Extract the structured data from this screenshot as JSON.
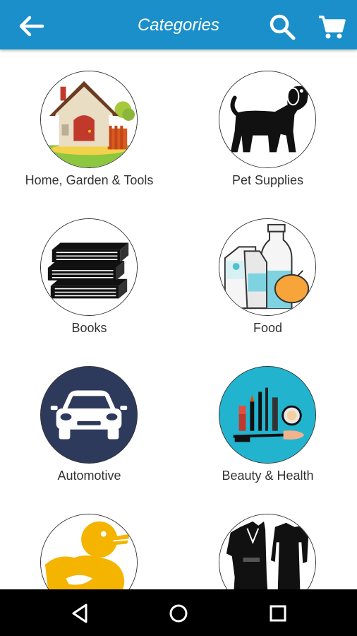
{
  "appbar": {
    "title": "Categories",
    "color": "#1a8fc9",
    "icons": {
      "back": "arrow-left-icon",
      "search": "search-icon",
      "cart": "shopping-cart-icon"
    }
  },
  "categories": [
    {
      "label": "Home, Garden & Tools",
      "icon": "house-icon"
    },
    {
      "label": "Pet Supplies",
      "icon": "dog-icon"
    },
    {
      "label": "Books",
      "icon": "books-stack-icon"
    },
    {
      "label": "Food",
      "icon": "milk-bottles-icon"
    },
    {
      "label": "Automotive",
      "icon": "car-icon"
    },
    {
      "label": "Beauty & Health",
      "icon": "makeup-icon"
    },
    {
      "label": "",
      "icon": "rubber-duck-icon"
    },
    {
      "label": "",
      "icon": "clothing-icon"
    }
  ],
  "navbar": {
    "icons": [
      "back-triangle-icon",
      "home-circle-icon",
      "recents-square-icon"
    ]
  }
}
